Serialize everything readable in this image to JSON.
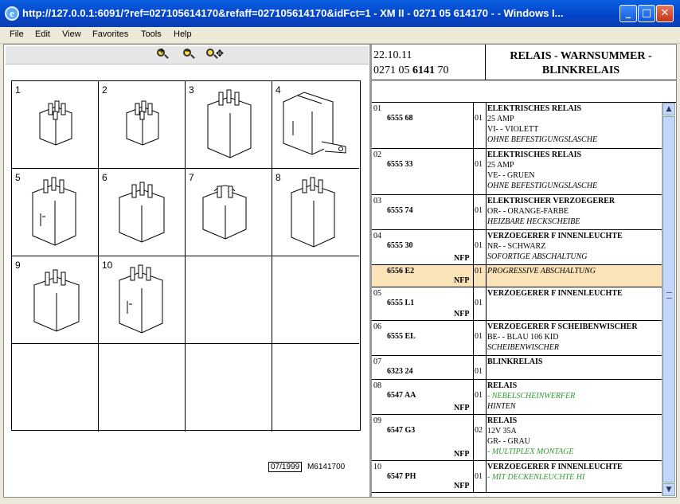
{
  "window": {
    "title": "http://127.0.0.1:6091/?ref=027105614170&refaff=027105614170&idFct=1 - XM II - 0271 05 614170 -  - Windows I...",
    "minimize": "_",
    "maximize": "□",
    "close": "✕"
  },
  "menu": [
    "File",
    "Edit",
    "View",
    "Favorites",
    "Tools",
    "Help"
  ],
  "toolbar": {
    "zoom_in": "+",
    "zoom_out": "−",
    "zoom_pan": "✥"
  },
  "diagram": {
    "cells": [
      "1",
      "2",
      "3",
      "4",
      "5",
      "6",
      "7",
      "8",
      "9",
      "10"
    ],
    "date_ref": "07/1999",
    "drawing_ref": "M6141700"
  },
  "header": {
    "date": "22.10.11",
    "code_prefix": "0271 05 ",
    "code_bold": "6141",
    "code_suffix": " 70",
    "title": "RELAIS - WARNSUMMER - BLINKRELAIS"
  },
  "rows": [
    {
      "idx": "01",
      "part": "6555 68",
      "nfp": "",
      "qty": "01",
      "title": "ELEKTRISCHES RELAIS",
      "lines": [
        [
          "n",
          "25 AMP"
        ],
        [
          "n",
          "VI- - VIOLETT"
        ],
        [
          "i",
          "OHNE BEFESTIGUNGSLASCHE"
        ]
      ]
    },
    {
      "idx": "02",
      "part": "6555 33",
      "nfp": "",
      "qty": "01",
      "title": "ELEKTRISCHES RELAIS",
      "lines": [
        [
          "n",
          "25 AMP"
        ],
        [
          "n",
          "VE- - GRUEN"
        ],
        [
          "i",
          "OHNE BEFESTIGUNGSLASCHE"
        ]
      ]
    },
    {
      "idx": "03",
      "part": "6555 74",
      "nfp": "",
      "qty": "01",
      "title": "ELEKTRISCHER VERZOEGERER",
      "lines": [
        [
          "n",
          "OR- - ORANGE-FARBE"
        ],
        [
          "i",
          "HEIZBARE HECKSCHEIBE"
        ]
      ]
    },
    {
      "idx": "04",
      "part": "6555 30",
      "nfp": "NFP",
      "qty": "01",
      "title": "VERZOEGERER F INNENLEUCHTE",
      "lines": [
        [
          "n",
          "NR- - SCHWARZ"
        ],
        [
          "i",
          "SOFORTIGE ABSCHALTUNG"
        ]
      ]
    },
    {
      "idx": "",
      "part": "6556 E2",
      "nfp": "NFP",
      "qty": "01",
      "title": "",
      "lines": [
        [
          "i",
          "PROGRESSIVE ABSCHALTUNG"
        ]
      ]
    },
    {
      "idx": "05",
      "part": "6555 L1",
      "nfp": "NFP",
      "qty": "01",
      "title": "VERZOEGERER F INNENLEUCHTE",
      "lines": []
    },
    {
      "idx": "06",
      "part": "6555 EL",
      "nfp": "",
      "qty": "01",
      "title": "VERZOEGERER F SCHEIBENWISCHER",
      "lines": [
        [
          "n",
          "BE- - BLAU 106 KID"
        ],
        [
          "i",
          "SCHEIBENWISCHER"
        ]
      ]
    },
    {
      "idx": "07",
      "part": "6323 24",
      "nfp": "",
      "qty": "01",
      "title": "BLINKRELAIS",
      "lines": []
    },
    {
      "idx": "08",
      "part": "6547 AA",
      "nfp": "NFP",
      "qty": "01",
      "title": "RELAIS",
      "lines": [
        [
          "g",
          "- NEBELSCHEINWERFER"
        ],
        [
          "i",
          "HINTEN"
        ]
      ]
    },
    {
      "idx": "09",
      "part": "6547 G3",
      "nfp": "NFP",
      "qty": "02",
      "title": "RELAIS",
      "lines": [
        [
          "n",
          "12V 35A"
        ],
        [
          "n",
          "GR- - GRAU"
        ],
        [
          "g",
          "- MULTIPLEX MONTAGE"
        ]
      ]
    },
    {
      "idx": "10",
      "part": "6547 PH",
      "nfp": "NFP",
      "qty": "01",
      "title": "VERZOEGERER F INNENLEUCHTE",
      "lines": [
        [
          "g",
          "- MIT DECKENLEUCHTE HI"
        ]
      ]
    }
  ],
  "scrollbar": {
    "up": "▲",
    "down": "▼"
  },
  "colors": {
    "titlebar": "#0443c7",
    "highlight_row": "#fbe3b8",
    "green_text": "#2e9b2e"
  }
}
